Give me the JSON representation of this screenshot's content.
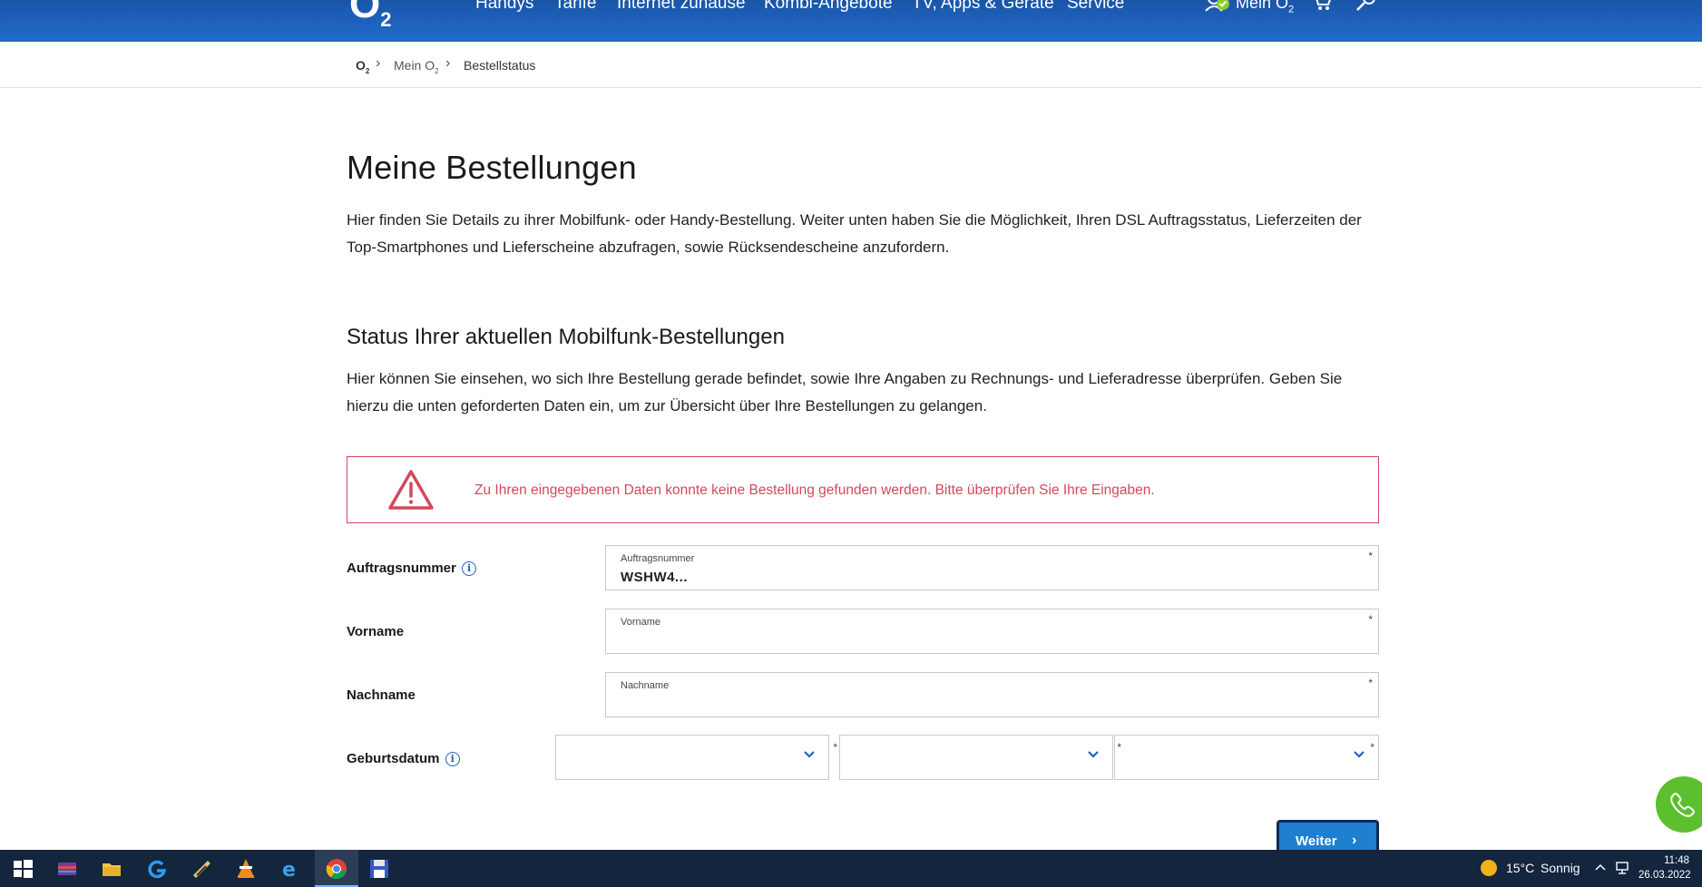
{
  "nav": {
    "logo": "O",
    "logo_sub": "2",
    "items": [
      "Handys",
      "Tarife",
      "Internet zuhause",
      "Kombi-Angebote",
      "TV, Apps & Geräte",
      "Service"
    ],
    "mein_o2": "Mein O",
    "mein_o2_sub": "2"
  },
  "breadcrumb": {
    "home": "O",
    "home_sub": "2",
    "item1": "Mein O",
    "item1_sub": "2",
    "item2": "Bestellstatus",
    "sep": "›"
  },
  "page": {
    "title": "Meine Bestellungen",
    "intro": "Hier finden Sie Details zu ihrer Mobilfunk- oder Handy-Bestellung. Weiter unten haben Sie die Möglichkeit, Ihren DSL Auftragsstatus, Lieferzeiten der Top-Smartphones und Lieferscheine abzufragen, sowie Rücksendescheine anzufordern.",
    "section_title": "Status Ihrer aktuellen Mobilfunk-Bestellungen",
    "section_intro": "Hier können Sie einsehen, wo sich Ihre Bestellung gerade befindet, sowie Ihre Angaben zu Rechnungs- und Lieferadresse überprüfen. Geben Sie hierzu die unten geforderten Daten ein, um zur Übersicht über Ihre Bestellungen zu gelangen."
  },
  "alert": {
    "message": "Zu Ihren eingegebenen Daten konnte keine Bestellung gefunden werden. Bitte überprüfen Sie Ihre Eingaben.",
    "color": "#d4485c"
  },
  "form": {
    "auftragsnummer": {
      "label": "Auftragsnummer",
      "field_label": "Auftragsnummer",
      "value": "WSHW4..."
    },
    "vorname": {
      "label": "Vorname",
      "field_label": "Vorname",
      "value": ""
    },
    "nachname": {
      "label": "Nachname",
      "field_label": "Nachname",
      "value": ""
    },
    "geburtsdatum": {
      "label": "Geburtsdatum",
      "day": "",
      "month": "",
      "year": ""
    },
    "required_mark": "*",
    "info": "i",
    "submit": "Weiter",
    "submit_arrow": "›"
  },
  "taskbar": {
    "weather_temp": "15°C",
    "weather_text": "Sonnig",
    "time": "11:48",
    "date": "26.03.2022"
  },
  "colors": {
    "brand_blue": "#1e63bf",
    "button_blue": "#1e7fd0",
    "call_green": "#5bbf2e"
  }
}
